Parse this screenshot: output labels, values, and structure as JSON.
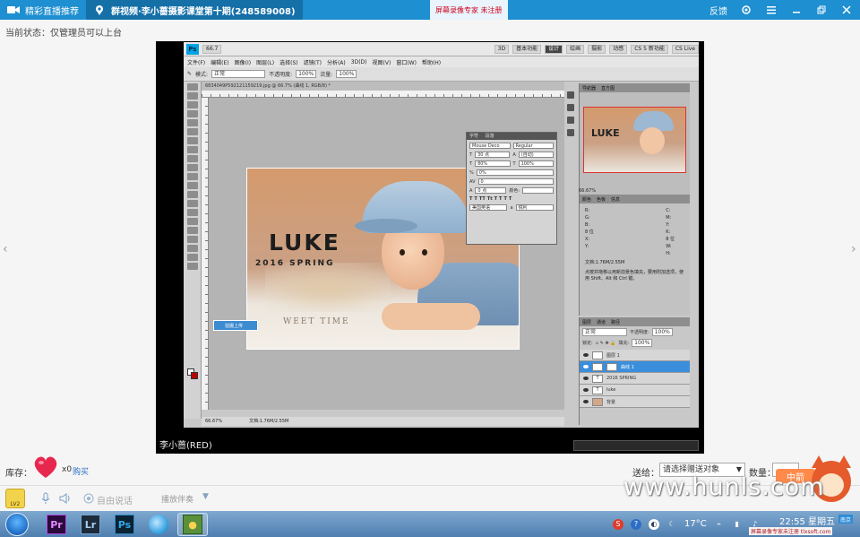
{
  "topbar": {
    "tab1_label": "精彩直播推荐",
    "tab2_label": "群视频·李小蔷摄影课堂第十期(248589008)",
    "center_notice": "屏幕录像专家 未注册",
    "feedback_label": "反馈",
    "colors": {
      "bar": "#1e8fd0",
      "active_tab": "#1570a8"
    }
  },
  "status_line": "当前状态：仅管理员可以上台",
  "video": {
    "speaker_label": "李小蔷(RED)",
    "photoshop": {
      "menu_items": [
        "文件(F)",
        "编辑(E)",
        "图像(I)",
        "图层(L)",
        "选择(S)",
        "滤镜(T)",
        "分析(A)",
        "3D(D)",
        "视图(V)",
        "窗口(W)",
        "帮助(H)"
      ],
      "workspace_buttons": [
        "3D",
        "基本功能",
        "设计",
        "绘画",
        "摄影",
        "动感",
        "CS 5 新功能",
        "CS Live"
      ],
      "zoom_box": "66.7",
      "options": {
        "mode_label": "模式:",
        "mode_value": "正常",
        "opacity_label": "不透明度:",
        "opacity_value": "100%",
        "flow_label": "流量:",
        "flow_value": "100%"
      },
      "doc_tab": "6834049P592121159219.jpg @ 66.7% (曲线 1, RGB/8) *",
      "status_zoom": "66.67%",
      "status_doc": "文档:1.76M/2.55M",
      "photo": {
        "title": "LUKE",
        "subtitle": "2016 SPRING",
        "tagline": "WEET TIME"
      },
      "upload_badge": "拍摄上传",
      "character_panel": {
        "tabs": [
          "字符",
          "段落"
        ],
        "font_family": "Mouse Deco",
        "font_style": "Regular",
        "size": "30 点",
        "leading": "(自动)",
        "tracking": "80%",
        "scale": "100%",
        "kerning": "0%",
        "baseline": "0",
        "shift": "0 点",
        "color_label": "颜色:",
        "language": "美国英语",
        "aa": "锐利"
      },
      "navigator": {
        "tabs": [
          "导航器",
          "直方图"
        ],
        "thumb_title": "LUKE",
        "zoom": "66.67%"
      },
      "info_panel": {
        "tabs": [
          "颜色",
          "色板",
          "信息"
        ],
        "lines": [
          "R:",
          "G:",
          "B:",
          "8 位",
          "X:",
          "Y:",
          "C:",
          "M:",
          "Y:",
          "K:",
          "8 位",
          "W:",
          "H:"
        ],
        "doc": "文档:1.76M/2.55M",
        "tip": "点按并拖移以用新前景色填充，要用附加选项，使用 Shift、Alt 和 Ctrl 键。"
      },
      "layers_panel": {
        "tabs": [
          "图层",
          "通道",
          "路径"
        ],
        "blend_mode": "正常",
        "opacity": "100%",
        "fill": "100%",
        "lock_label": "锁定:",
        "fill_label": "填充:",
        "opacity_label": "不透明度:",
        "layers": [
          {
            "name": "图层 1",
            "selected": false
          },
          {
            "name": "曲线 1",
            "selected": true
          },
          {
            "name": "2016 SPRING",
            "selected": false
          },
          {
            "name": "luke",
            "selected": false
          },
          {
            "name": "背景",
            "selected": false
          }
        ]
      }
    }
  },
  "gift": {
    "stock_label": "库存：",
    "count": "x0",
    "buy_label": "购买",
    "send_to_label": "送给：",
    "send_to_placeholder": "请选择赠送对象",
    "qty_label": "数量："
  },
  "toolbar": {
    "level_label": "LV2",
    "free_talk_label": "自由说话",
    "accompany_label": "播放伴奏"
  },
  "watermark": "www.hunls.com",
  "mascot_tag": "中箭",
  "taskbar": {
    "apps": [
      "Pr",
      "Lr",
      "Ps"
    ],
    "tray_temp": "17°C",
    "clock": "22:55 星期五",
    "clock_badge": "南京",
    "tray_credit": "屏幕录像专家未注册 tlxsoft.com"
  }
}
